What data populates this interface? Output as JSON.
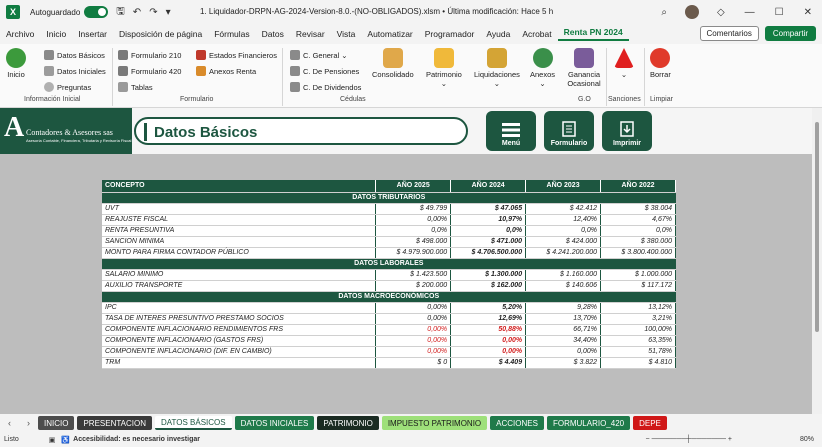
{
  "titlebar": {
    "autosave_label": "Autoguardado",
    "doc_title": "1. Liquidador-DRPN-AG-2024-Version-8.0.-(NO-OBLIGADOS).xlsm • Última modificación: Hace 5 h"
  },
  "menu": [
    "Archivo",
    "Inicio",
    "Insertar",
    "Disposición de página",
    "Fórmulas",
    "Datos",
    "Revisar",
    "Vista",
    "Automatizar",
    "Programador",
    "Ayuda",
    "Acrobat",
    "Renta PN 2024"
  ],
  "menu_actions": {
    "comments": "Comentarios",
    "share": "Compartir"
  },
  "ribbon": {
    "inicio": "Inicio",
    "datos_basicos": "Datos Básicos",
    "datos_iniciales": "Datos Iniciales",
    "preguntas": "Preguntas",
    "formulario_210": "Formulario 210",
    "formulario_420": "Formulario 420",
    "tablas": "Tablas",
    "estados_financieros": "Estados Financieros",
    "anexos_renta": "Anexos Renta",
    "c_general": "C. General",
    "c_pensiones": "C. De Pensiones",
    "c_dividendos": "C. De Dividendos",
    "consolidado": "Consolidado",
    "patrimonio": "Patrimonio",
    "liquidaciones": "Liquidaciones",
    "anexos": "Anexos",
    "ganancia_ocasional": "Ganancia Ocasional",
    "sanciones": "Sanciones",
    "borrar": "Borrar",
    "groups": {
      "informacion_inicial": "Información Inicial",
      "formulario": "Formulario",
      "cedulas": "Cédulas",
      "go": "G.O",
      "sanciones": "Sanciones",
      "limpiar": "Limpiar"
    }
  },
  "banner": {
    "logo_text": "Contadores & Asesores sas",
    "logo_sub": "Asesoría Contable, Financiera, Tributaria y Revisoría Fiscal",
    "page_title": "Datos Básicos",
    "btn_menu": "Menú",
    "btn_formulario": "Formulario",
    "btn_imprimir": "Imprimir"
  },
  "table": {
    "headers": [
      "CONCEPTO",
      "AÑO 2025",
      "AÑO 2024",
      "AÑO 2023",
      "AÑO 2022"
    ],
    "sections": [
      {
        "title": "DATOS TRIBUTARIOS",
        "rows": [
          [
            "UVT",
            "$ 49.799",
            "$ 47.065",
            "$ 42.412",
            "$ 38.004"
          ],
          [
            "REAJUSTE FISCAL",
            "0,00%",
            "10,97%",
            "12,40%",
            "4,67%"
          ],
          [
            "RENTA PRESUNTIVA",
            "0,0%",
            "0,0%",
            "0,0%",
            "0,0%"
          ],
          [
            "SANCION MINIMA",
            "$ 498.000",
            "$ 471.000",
            "$ 424.000",
            "$ 380.000"
          ],
          [
            "MONTO PARA FIRMA CONTADOR PÚBLICO",
            "$ 4.979.900.000",
            "$ 4.706.500.000",
            "$ 4.241.200.000",
            "$ 3.800.400.000"
          ]
        ]
      },
      {
        "title": "DATOS LABORALES",
        "rows": [
          [
            "SALARIO MINIMO",
            "$ 1.423.500",
            "$ 1.300.000",
            "$ 1.160.000",
            "$ 1.000.000"
          ],
          [
            "AUXILIO TRANSPORTE",
            "$ 200.000",
            "$ 162.000",
            "$ 140.606",
            "$ 117.172"
          ]
        ]
      },
      {
        "title": "DATOS MACROECONÓMICOS",
        "rows": [
          [
            "IPC",
            "0,00%",
            "5,20%",
            "9,28%",
            "13,12%"
          ],
          [
            "TASA DE INTERES PRESUNTIVO PRESTAMO SOCIOS",
            "0,00%",
            "12,69%",
            "13,70%",
            "3,21%"
          ],
          [
            "COMPONENTE INFLACIONARIO RENDIMIENTOS FRS",
            "0,00%",
            "50,88%",
            "66,71%",
            "100,00%"
          ],
          [
            "COMPONENTE INFLACIONARIO (GASTOS FRS)",
            "0,00%",
            "0,00%",
            "34,40%",
            "63,35%"
          ],
          [
            "COMPONENTE INFLACIONARIO (DIF. EN CAMBIO)",
            "0,00%",
            "0,00%",
            "0,00%",
            "51,78%"
          ],
          [
            "TRM",
            "$ 0",
            "$ 4.409",
            "$ 3.822",
            "$ 4.810"
          ]
        ]
      }
    ]
  },
  "sheet_tabs": [
    {
      "label": "INICIO",
      "bg": "#4d4d4d",
      "fg": "#ffffff"
    },
    {
      "label": "PRESENTACION",
      "bg": "#3a3a3a",
      "fg": "#ffffff"
    },
    {
      "label": "DATOS BÁSICOS",
      "bg": "#ffffff",
      "fg": "#1d5640"
    },
    {
      "label": "DATOS INICIALES",
      "bg": "#1f7a4a",
      "fg": "#ffffff"
    },
    {
      "label": "PATRIMONIO",
      "bg": "#1a2b22",
      "fg": "#ffffff"
    },
    {
      "label": "IMPUESTO PATRIMONIO",
      "bg": "#9ee07a",
      "fg": "#1a1a1a"
    },
    {
      "label": "ACCIONES",
      "bg": "#1f7a4a",
      "fg": "#ffffff"
    },
    {
      "label": "FORMULARIO_420",
      "bg": "#1f7a4a",
      "fg": "#ffffff"
    },
    {
      "label": "DEPE",
      "bg": "#d01818",
      "fg": "#ffffff"
    }
  ],
  "status": {
    "ready": "Listo",
    "accessibility": "Accesibilidad: es necesario investigar",
    "zoom": "80%"
  }
}
